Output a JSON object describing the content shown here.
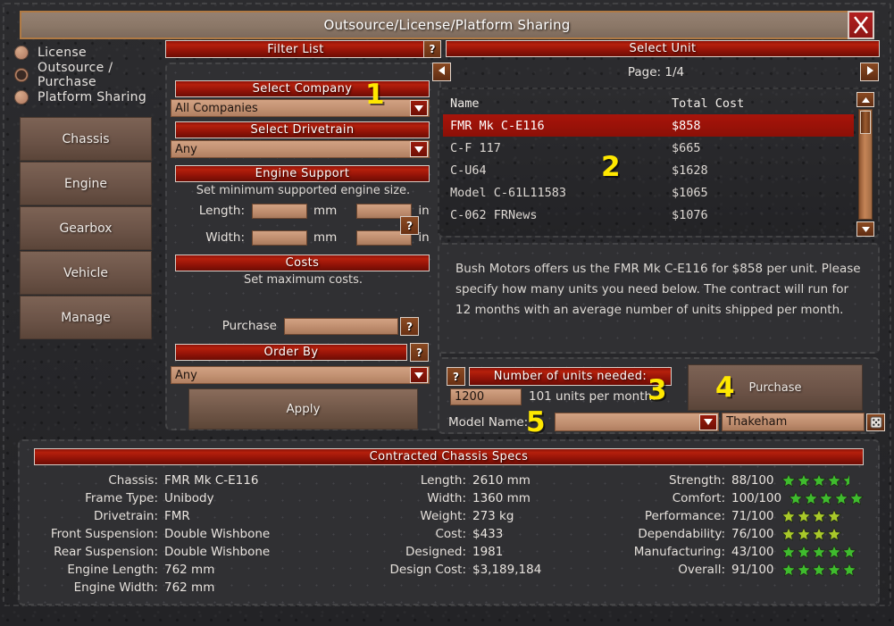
{
  "window": {
    "title": "Outsource/License/Platform Sharing",
    "close_icon": "close-x-icon"
  },
  "sidebar": {
    "modes": [
      {
        "label": "License",
        "selected": false
      },
      {
        "label": "Outsource / Purchase",
        "selected": true
      },
      {
        "label": "Platform Sharing",
        "selected": false
      }
    ],
    "nav": [
      "Chassis",
      "Engine",
      "Gearbox",
      "Vehicle",
      "Manage"
    ]
  },
  "filter": {
    "title": "Filter List",
    "help_label": "?",
    "company": {
      "title": "Select Company",
      "value": "All Companies"
    },
    "drivetrain": {
      "title": "Select Drivetrain",
      "value": "Any"
    },
    "engine_support": {
      "title": "Engine Support",
      "subtitle": "Set minimum supported engine size.",
      "length_label": "Length:",
      "width_label": "Width:",
      "mm_label": "mm",
      "in_label": "in",
      "length_mm": "",
      "length_in": "",
      "width_mm": "",
      "width_in": "",
      "help_label": "?"
    },
    "costs": {
      "title": "Costs",
      "subtitle": "Set maximum costs.",
      "purchase_label": "Purchase",
      "purchase_value": "",
      "help_label": "?"
    },
    "order_by": {
      "title": "Order By",
      "value": "Any",
      "help_label": "?"
    },
    "apply_label": "Apply"
  },
  "select_unit": {
    "title": "Select Unit",
    "page_label": "Page: 1/4",
    "prev_icon": "triangle-left-icon",
    "next_icon": "triangle-right-icon",
    "columns": [
      "Name",
      "Total Cost"
    ],
    "rows": [
      {
        "name": "FMR Mk C-E116",
        "cost": "$858",
        "selected": true
      },
      {
        "name": "C-F 117",
        "cost": "$665",
        "selected": false
      },
      {
        "name": "C-U64",
        "cost": "$1628",
        "selected": false
      },
      {
        "name": "Model C-61L11583",
        "cost": "$1065",
        "selected": false
      },
      {
        "name": "C-062 FRNews",
        "cost": "$1076",
        "selected": false
      }
    ],
    "scroll_up_icon": "triangle-up-icon",
    "scroll_down_icon": "triangle-down-icon"
  },
  "description": "Bush Motors offers us the FMR Mk C-E116 for $858 per unit. Please specify how many units you need below. The contract will run for 12 months with an average number of units shipped per month.",
  "order": {
    "help_label": "?",
    "units_title": "Number of units needed:",
    "units_value": "1200",
    "units_rate": "101 units per month.",
    "purchase_button": "Purchase",
    "model_name_label": "Model Name:",
    "model_dropdown_value": "",
    "model_name_value": "Thakeham",
    "dice_icon": "dice-icon"
  },
  "specs": {
    "title": "Contracted Chassis Specs",
    "left": [
      {
        "key": "Chassis:",
        "value": "FMR Mk C-E116"
      },
      {
        "key": "Frame Type:",
        "value": "Unibody"
      },
      {
        "key": "Drivetrain:",
        "value": "FMR"
      },
      {
        "key": "Front Suspension:",
        "value": "Double Wishbone"
      },
      {
        "key": "Rear Suspension:",
        "value": "Double Wishbone"
      },
      {
        "key": "Engine Length:",
        "value": "762 mm"
      },
      {
        "key": "Engine Width:",
        "value": "762 mm"
      }
    ],
    "middle": [
      {
        "key": "Length:",
        "value": "2610 mm"
      },
      {
        "key": "Width:",
        "value": "1360 mm"
      },
      {
        "key": "Weight:",
        "value": "273 kg"
      },
      {
        "key": "Cost:",
        "value": "$433"
      },
      {
        "key": "Designed:",
        "value": "1981"
      },
      {
        "key": "Design Cost:",
        "value": "$3,189,184"
      }
    ],
    "right": [
      {
        "key": "Strength:",
        "value": "88/100",
        "stars": 4.5,
        "color": "#3fbb2e"
      },
      {
        "key": "Comfort:",
        "value": "100/100",
        "stars": 5,
        "color": "#3fbb2e"
      },
      {
        "key": "Performance:",
        "value": "71/100",
        "stars": 4,
        "color": "#a9c82a"
      },
      {
        "key": "Dependability:",
        "value": "76/100",
        "stars": 4,
        "color": "#a9c82a"
      },
      {
        "key": "Manufacturing:",
        "value": "43/100",
        "stars": 5,
        "color": "#3fbb2e"
      },
      {
        "key": "Overall:",
        "value": "91/100",
        "stars": 5,
        "color": "#3fbb2e"
      }
    ]
  },
  "badges": {
    "one": "1",
    "two": "2",
    "three": "3",
    "four": "4",
    "five": "5"
  },
  "colors": {
    "accent_red": "#a8140a",
    "highlight_yellow": "#ffe800",
    "panel": "#2a2a2c"
  }
}
